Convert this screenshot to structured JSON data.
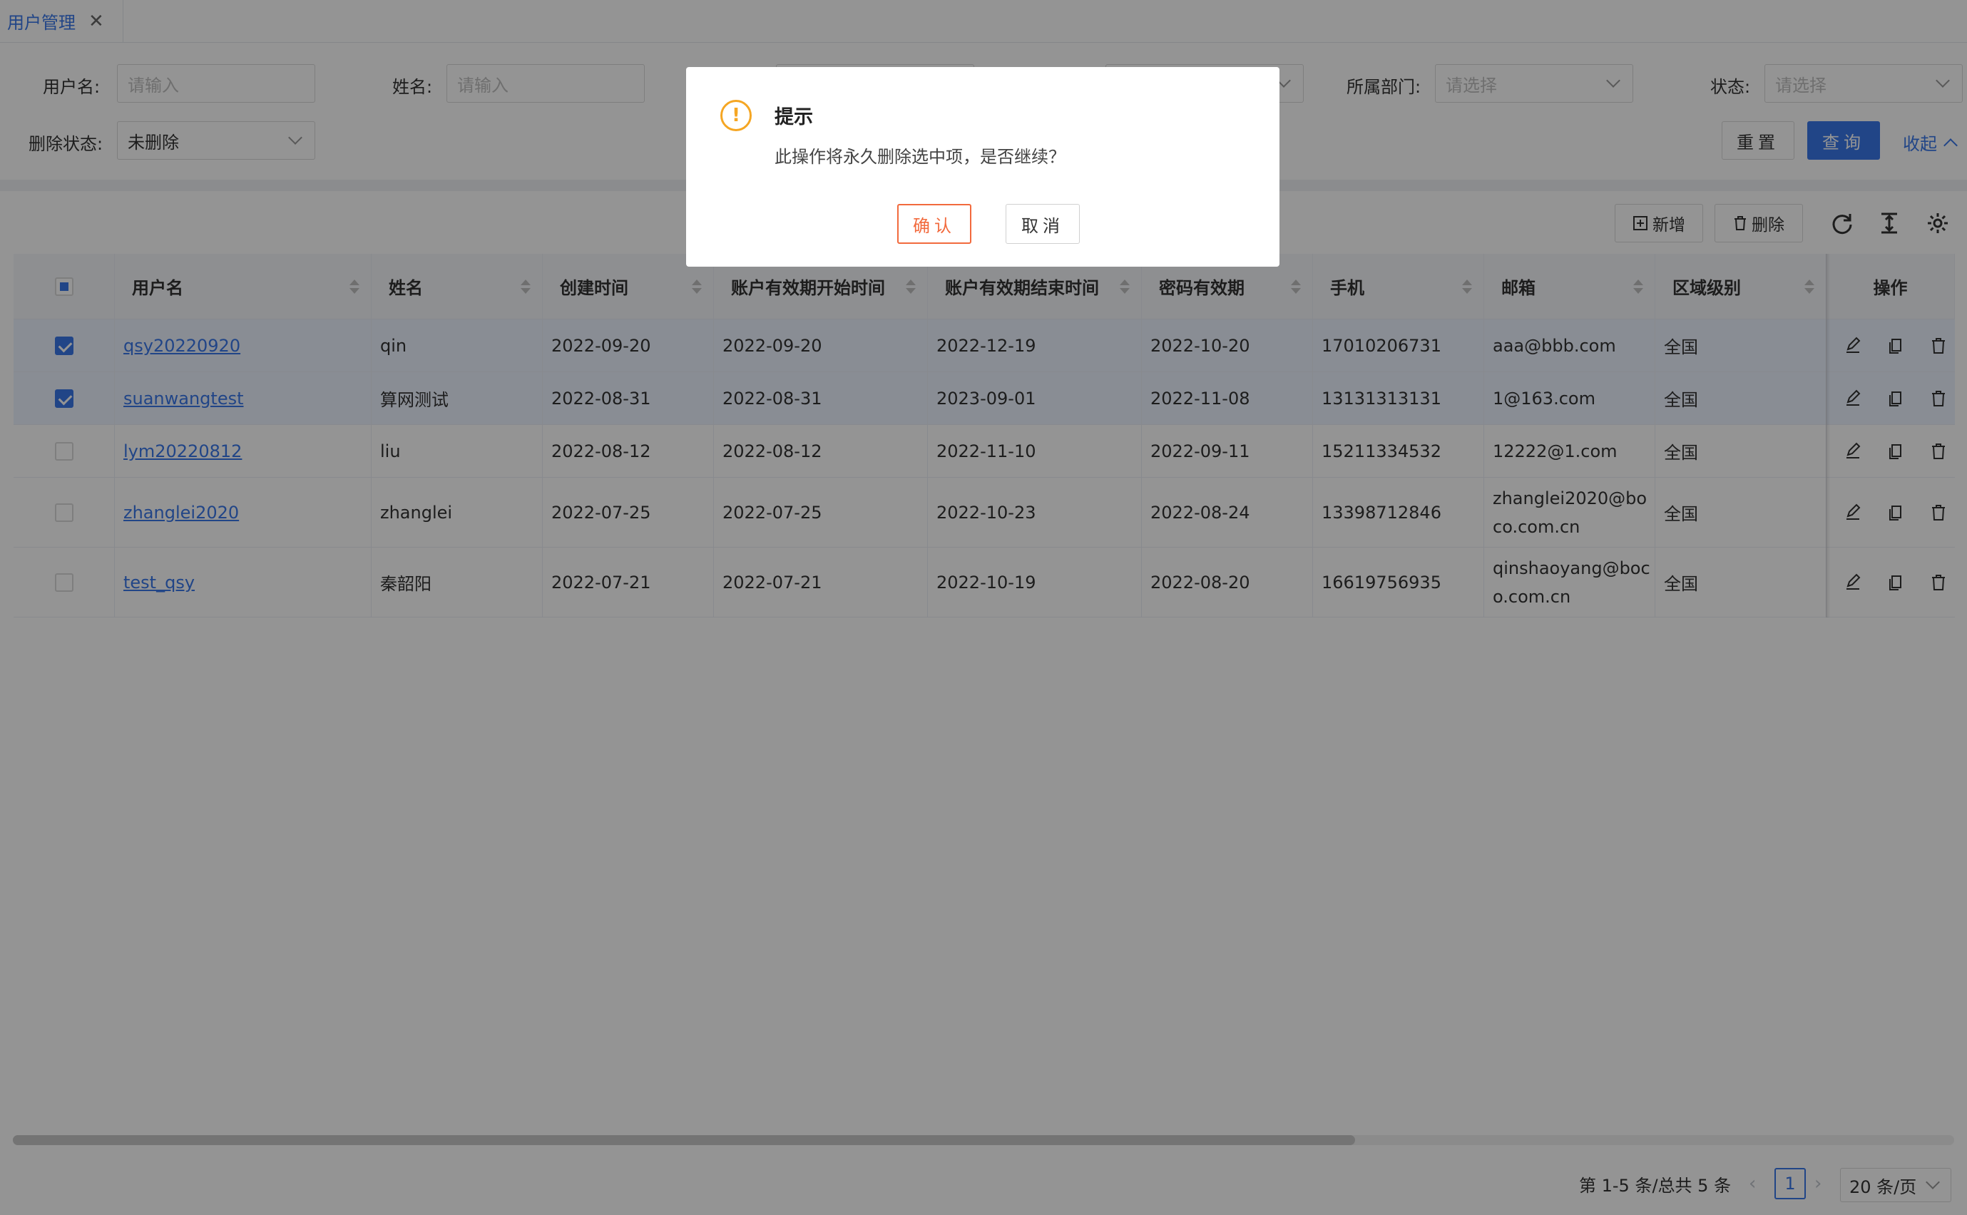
{
  "tab": {
    "label": "用户管理",
    "close": "✕"
  },
  "filter": {
    "username": {
      "label": "用户名:",
      "placeholder": "请输入"
    },
    "name": {
      "label": "姓名:",
      "placeholder": "请输入"
    },
    "department": {
      "label": "所属部门:",
      "placeholder": "请选择"
    },
    "status": {
      "label": "状态:",
      "placeholder": "请选择"
    },
    "delete_status": {
      "label": "删除状态:",
      "value": "未删除"
    },
    "reset_label": "重置",
    "query_label": "查询",
    "collapse_label": "收起"
  },
  "toolbar": {
    "add_label": "新增",
    "delete_label": "删除"
  },
  "table": {
    "columns": [
      "用户名",
      "姓名",
      "创建时间",
      "账户有效期开始时间",
      "账户有效期结束时间",
      "密码有效期",
      "手机",
      "邮箱",
      "区域级别",
      "操作"
    ],
    "rows": [
      {
        "checked": true,
        "username": "qsy20220920",
        "name": "qin",
        "created": "2022-09-20",
        "start": "2022-09-20",
        "end": "2022-12-19",
        "pwd": "2022-10-20",
        "phone": "17010206731",
        "email": "aaa@bbb.com",
        "region": "全国"
      },
      {
        "checked": true,
        "username": "suanwangtest",
        "name": "算网测试",
        "created": "2022-08-31",
        "start": "2022-08-31",
        "end": "2023-09-01",
        "pwd": "2022-11-08",
        "phone": "13131313131",
        "email": "1@163.com",
        "region": "全国"
      },
      {
        "checked": false,
        "username": "lym20220812",
        "name": "liu",
        "created": "2022-08-12",
        "start": "2022-08-12",
        "end": "2022-11-10",
        "pwd": "2022-09-11",
        "phone": "15211334532",
        "email": "12222@1.com",
        "region": "全国"
      },
      {
        "checked": false,
        "username": "zhanglei2020",
        "name": "zhanglei",
        "created": "2022-07-25",
        "start": "2022-07-25",
        "end": "2022-10-23",
        "pwd": "2022-08-24",
        "phone": "13398712846",
        "email": "zhanglei2020@boco.com.cn",
        "region": "全国"
      },
      {
        "checked": false,
        "username": "test_qsy",
        "name": "秦韶阳",
        "created": "2022-07-21",
        "start": "2022-07-21",
        "end": "2022-10-19",
        "pwd": "2022-08-20",
        "phone": "16619756935",
        "email": "qinshaoyang@boco.com.cn",
        "region": "全国"
      }
    ]
  },
  "pagination": {
    "total_text": "第 1-5 条/总共 5 条",
    "current_page": "1",
    "page_size": "20 条/页"
  },
  "dialog": {
    "title": "提示",
    "message": "此操作将永久删除选中项，是否继续？",
    "confirm_label": "确认",
    "cancel_label": "取消",
    "icon_glyph": "!"
  },
  "colors": {
    "primary": "#3a77e8",
    "warning": "#f5a623",
    "danger": "#f26a3d"
  }
}
